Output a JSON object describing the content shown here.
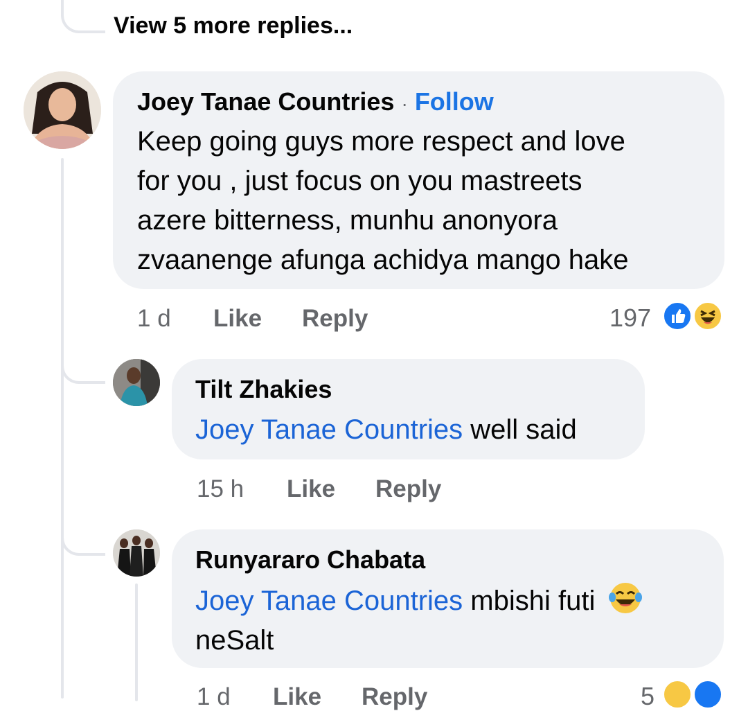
{
  "thread": {
    "view_more_label": "View 5 more replies..."
  },
  "comment": {
    "author": "Joey Tanae Countries",
    "separator": "·",
    "follow_label": "Follow",
    "text_lines": [
      "Keep going guys more respect and love",
      "for you , just focus on you mastreets",
      "azere bitterness, munhu anonyora",
      "zvaanenge afunga achidya mango hake"
    ],
    "time": "1 d",
    "like_label": "Like",
    "reply_label": "Reply",
    "reaction_count": "197",
    "reactions": [
      "like-icon",
      "haha-icon"
    ]
  },
  "replies": [
    {
      "author": "Tilt Zhakies",
      "mention": "Joey Tanae Countries",
      "text": " well said",
      "time": "15 h",
      "like_label": "Like",
      "reply_label": "Reply"
    },
    {
      "author": "Runyararo Chabata",
      "mention": "Joey Tanae Countries",
      "text": " mbishi futi",
      "emoji": "😂",
      "text_line2": "neSalt",
      "time": "1 d",
      "like_label": "Like",
      "reply_label": "Reply",
      "reaction_count": "5",
      "reactions": [
        "haha-icon",
        "like-icon"
      ]
    }
  ],
  "colors": {
    "bubble": "#f0f2f5",
    "link": "#1b74e4",
    "mention": "#1b64d6",
    "meta": "#65676b",
    "thread_line": "#e4e6eb",
    "like_blue": "#1877f2",
    "haha_yellow": "#f7c844"
  }
}
